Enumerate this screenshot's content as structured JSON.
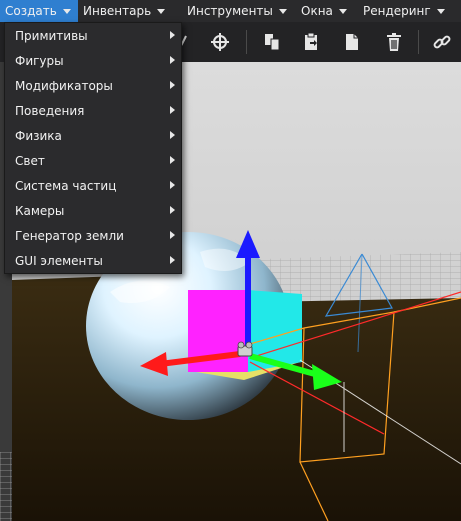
{
  "menubar": {
    "items": [
      {
        "label": "Создать",
        "active": true
      },
      {
        "label": "Инвентарь",
        "active": false
      },
      {
        "label": "Инструменты",
        "active": false
      },
      {
        "label": "Окна",
        "active": false
      },
      {
        "label": "Рендеринг",
        "active": false
      }
    ],
    "accent": "#2f7fd0"
  },
  "toolbar": {
    "icons": [
      "pointer-icon",
      "move-crosshair-icon",
      "copy-icon",
      "paste-icon",
      "duplicate-icon",
      "trash-icon",
      "link-icon"
    ]
  },
  "dropdown": {
    "items": [
      {
        "label": "Примитивы"
      },
      {
        "label": "Фигуры"
      },
      {
        "label": "Модификаторы"
      },
      {
        "label": "Поведения"
      },
      {
        "label": "Физика"
      },
      {
        "label": "Свет"
      },
      {
        "label": "Система частиц"
      },
      {
        "label": "Камеры"
      },
      {
        "label": "Генератор земли"
      },
      {
        "label": "GUI элементы"
      }
    ]
  },
  "scene": {
    "axis_colors": {
      "x": "#ff1a1a",
      "y": "#1a1aff",
      "z": "#1aff1a"
    },
    "box_colors": {
      "front": "#ff22ff",
      "side": "#22e8e8",
      "top": "#e6e066"
    }
  }
}
